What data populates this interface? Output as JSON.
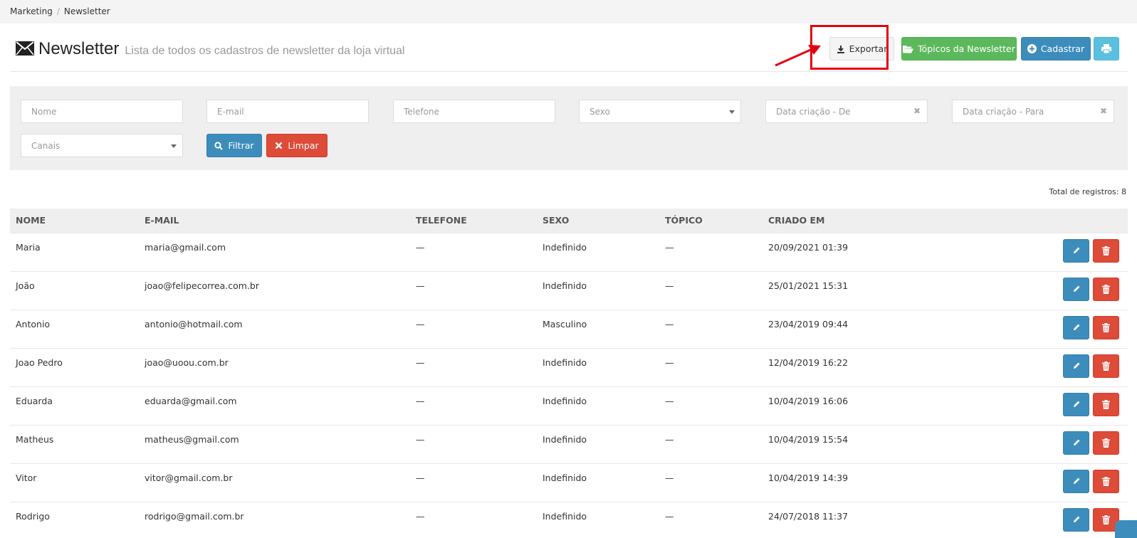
{
  "breadcrumb": [
    "Marketing",
    "Newsletter"
  ],
  "header": {
    "title": "Newsletter",
    "subtitle": "Lista de todos os cadastros de newsletter da loja virtual",
    "icon": "envelope-icon"
  },
  "toolbar": {
    "export_label": "Exportar",
    "topics_label": "Tópicos da Newsletter",
    "new_label": "Cadastrar",
    "print_icon": "print-icon"
  },
  "filters": {
    "name_placeholder": "Nome",
    "email_placeholder": "E-mail",
    "phone_placeholder": "Telefone",
    "sex_placeholder": "Sexo",
    "date_from_placeholder": "Data criação - De",
    "date_to_placeholder": "Data criação - Para",
    "channels_placeholder": "Canais",
    "filter_label": "Filtrar",
    "clear_label": "Limpar"
  },
  "total_label": "Total de registros: 8",
  "table": {
    "columns": [
      "Nome",
      "E-mail",
      "Telefone",
      "Sexo",
      "Tópico",
      "Criado em"
    ],
    "rows": [
      [
        "Maria",
        "maria@gmail.com",
        "—",
        "Indefinido",
        "—",
        "20/09/2021 01:39"
      ],
      [
        "João",
        "joao@felipecorrea.com.br",
        "—",
        "Indefinido",
        "—",
        "25/01/2021 15:31"
      ],
      [
        "Antonio",
        "antonio@hotmail.com",
        "—",
        "Masculino",
        "—",
        "23/04/2019 09:44"
      ],
      [
        "Joao Pedro",
        "joao@uoou.com.br",
        "—",
        "Indefinido",
        "—",
        "12/04/2019 16:22"
      ],
      [
        "Eduarda",
        "eduarda@gmail.com",
        "—",
        "Indefinido",
        "—",
        "10/04/2019 16:06"
      ],
      [
        "Matheus",
        "matheus@gmail.com",
        "—",
        "Indefinido",
        "—",
        "10/04/2019 15:54"
      ],
      [
        "Vitor",
        "vitor@gmail.com.br",
        "—",
        "Indefinido",
        "—",
        "10/04/2019 14:39"
      ],
      [
        "Rodrigo",
        "rodrigo@gmail.com.br",
        "—",
        "Indefinido",
        "—",
        "24/07/2018 11:37"
      ]
    ]
  },
  "colors": {
    "primary": "#3c8dbc",
    "success": "#5cb85c",
    "danger": "#dd4b39",
    "info": "#5bc0de",
    "highlight": "#e5000f"
  }
}
